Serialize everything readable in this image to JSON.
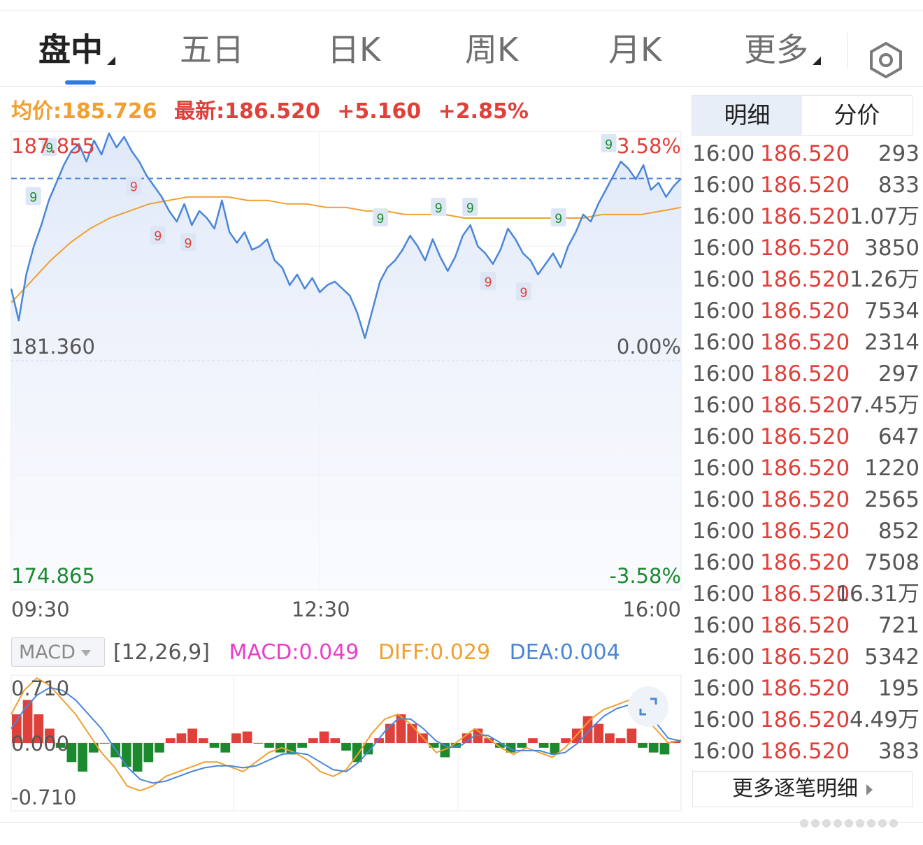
{
  "tabs": [
    {
      "label": "盘中",
      "active": true,
      "has_caret": true
    },
    {
      "label": "五日",
      "active": false,
      "has_caret": false
    },
    {
      "label": "日K",
      "active": false,
      "has_caret": false
    },
    {
      "label": "周K",
      "active": false,
      "has_caret": false
    },
    {
      "label": "月K",
      "active": false,
      "has_caret": false
    },
    {
      "label": "更多",
      "active": false,
      "has_caret": true
    }
  ],
  "settings_icon": "hexagon-gear-icon",
  "info": {
    "avg": "均价:185.726",
    "latest": "最新:186.520",
    "change": "+5.160",
    "change_pct": "+2.85%"
  },
  "colors": {
    "up": "#e0403a",
    "down": "#1b8a2e",
    "price_line": "#4a86d8",
    "avg_line": "#f0a030",
    "macd": "#e83ecb",
    "diff": "#f0a030",
    "dea": "#4a86d8",
    "tab_active_underline": "#2e7be6"
  },
  "price_axis": {
    "top_price": "187.855",
    "mid_price": "181.360",
    "bottom_price": "174.865",
    "top_pct": "3.58%",
    "mid_pct": "0.00%",
    "bottom_pct": "-3.58%",
    "prev_close": 181.36,
    "max": 187.855,
    "min": 174.865
  },
  "time_axis": [
    "09:30",
    "12:30",
    "16:00"
  ],
  "chart_data": {
    "type": "line",
    "x_labels": [
      "09:30",
      "12:30",
      "16:00"
    ],
    "y_range": [
      174.865,
      187.855
    ],
    "series": [
      {
        "values": [
          183.4,
          182.5,
          183.8,
          184.6,
          185.2,
          185.9,
          186.4,
          186.9,
          187.3,
          187.5,
          187.0,
          187.6,
          187.2,
          187.8,
          187.4,
          187.7,
          187.3,
          187.0,
          186.6,
          186.3,
          186.0,
          185.6,
          185.3,
          185.8,
          185.2,
          185.6,
          185.4,
          185.1,
          185.9,
          185.0,
          184.7,
          185.0,
          184.5,
          184.6,
          184.8,
          184.2,
          184.0,
          183.5,
          183.8,
          183.4,
          183.7,
          183.3,
          183.5,
          183.6,
          183.4,
          183.2,
          182.7,
          182.0,
          182.8,
          183.6,
          184.0,
          184.2,
          184.5,
          184.9,
          184.6,
          184.2,
          184.8,
          184.3,
          183.9,
          184.3,
          184.9,
          185.2,
          184.6,
          184.4,
          184.1,
          184.5,
          185.1,
          184.8,
          184.4,
          184.2,
          183.8,
          184.1,
          184.4,
          184.0,
          184.6,
          185.0,
          185.5,
          185.3,
          185.8,
          186.2,
          186.6,
          187.0,
          186.8,
          186.5,
          186.9,
          186.2,
          186.4,
          186.0,
          186.3,
          186.52
        ]
      }
    ]
  },
  "avg_values": [
    183.0,
    183.6,
    184.2,
    184.7,
    185.1,
    185.4,
    185.6,
    185.8,
    185.9,
    186.0,
    186.0,
    186.0,
    185.9,
    185.9,
    185.8,
    185.8,
    185.7,
    185.7,
    185.6,
    185.6,
    185.5,
    185.5,
    185.5,
    185.4,
    185.4,
    185.4,
    185.4,
    185.4,
    185.4,
    185.4,
    185.5,
    185.5,
    185.5,
    185.6,
    185.7
  ],
  "td_markers": [
    {
      "label": "9",
      "color": "green",
      "x": 0.033,
      "price": 186.0
    },
    {
      "label": "9",
      "color": "green",
      "x": 0.057,
      "price": 187.4
    },
    {
      "label": "9",
      "color": "red",
      "x": 0.183,
      "price": 186.3
    },
    {
      "label": "9",
      "color": "red",
      "x": 0.219,
      "price": 184.9
    },
    {
      "label": "9",
      "color": "red",
      "x": 0.264,
      "price": 184.7
    },
    {
      "label": "9",
      "color": "green",
      "x": 0.551,
      "price": 185.4
    },
    {
      "label": "9",
      "color": "green",
      "x": 0.638,
      "price": 185.7
    },
    {
      "label": "9",
      "color": "green",
      "x": 0.685,
      "price": 185.7
    },
    {
      "label": "9",
      "color": "red",
      "x": 0.712,
      "price": 183.6
    },
    {
      "label": "9",
      "color": "red",
      "x": 0.765,
      "price": 183.3
    },
    {
      "label": "9",
      "color": "green",
      "x": 0.817,
      "price": 185.4
    },
    {
      "label": "9",
      "color": "green",
      "x": 0.892,
      "price": 187.5
    }
  ],
  "macd": {
    "selector_label": "MACD",
    "params": "[12,26,9]",
    "macd_value": "MACD:0.049",
    "diff_value": "DIFF:0.029",
    "dea_value": "DEA:0.004",
    "axis_top": "0.710",
    "axis_mid": "0.000",
    "axis_bottom": "-0.710",
    "range": [
      -0.71,
      0.71
    ],
    "hist": [
      0.3,
      0.45,
      0.3,
      0.15,
      -0.05,
      -0.2,
      -0.3,
      -0.1,
      0.0,
      -0.15,
      -0.25,
      -0.3,
      -0.2,
      -0.1,
      0.05,
      0.1,
      0.15,
      0.05,
      -0.05,
      -0.1,
      0.1,
      0.12,
      0.0,
      -0.05,
      -0.1,
      -0.12,
      -0.05,
      0.05,
      0.12,
      0.05,
      -0.08,
      -0.2,
      -0.12,
      0.05,
      0.2,
      0.3,
      0.2,
      0.1,
      -0.05,
      -0.15,
      -0.05,
      0.1,
      0.15,
      0.05,
      -0.05,
      -0.1,
      -0.05,
      0.05,
      -0.05,
      -0.12,
      0.05,
      0.15,
      0.28,
      0.2,
      0.1,
      0.05,
      0.15,
      -0.05,
      -0.1,
      -0.12,
      0.02
    ],
    "diff": [
      0.3,
      0.55,
      0.68,
      0.6,
      0.45,
      0.3,
      0.1,
      -0.1,
      -0.25,
      -0.45,
      -0.5,
      -0.45,
      -0.35,
      -0.3,
      -0.25,
      -0.2,
      -0.2,
      -0.25,
      -0.3,
      -0.2,
      -0.1,
      -0.05,
      -0.1,
      -0.18,
      -0.3,
      -0.35,
      -0.28,
      -0.1,
      0.1,
      0.25,
      0.3,
      0.2,
      0.05,
      -0.1,
      -0.05,
      0.05,
      0.15,
      0.05,
      -0.05,
      -0.12,
      -0.05,
      -0.1,
      -0.15,
      -0.05,
      0.1,
      0.25,
      0.35,
      0.4,
      0.45,
      0.3,
      0.15,
      0.0,
      0.03
    ],
    "dea": [
      0.15,
      0.35,
      0.5,
      0.58,
      0.55,
      0.45,
      0.3,
      0.15,
      -0.05,
      -0.25,
      -0.38,
      -0.42,
      -0.4,
      -0.35,
      -0.3,
      -0.26,
      -0.24,
      -0.24,
      -0.26,
      -0.24,
      -0.18,
      -0.12,
      -0.1,
      -0.12,
      -0.2,
      -0.28,
      -0.3,
      -0.2,
      -0.05,
      0.12,
      0.25,
      0.25,
      0.15,
      0.02,
      -0.05,
      -0.02,
      0.08,
      0.08,
      0.0,
      -0.08,
      -0.08,
      -0.08,
      -0.12,
      -0.1,
      0.0,
      0.15,
      0.28,
      0.36,
      0.4,
      0.36,
      0.22,
      0.05,
      0.02
    ]
  },
  "detail_tabs": [
    {
      "label": "明细",
      "active": true
    },
    {
      "label": "分价",
      "active": false
    }
  ],
  "ticks": [
    {
      "time": "16:00",
      "price": "186.520",
      "vol": "293"
    },
    {
      "time": "16:00",
      "price": "186.520",
      "vol": "833"
    },
    {
      "time": "16:00",
      "price": "186.520",
      "vol": "1.07万"
    },
    {
      "time": "16:00",
      "price": "186.520",
      "vol": "3850"
    },
    {
      "time": "16:00",
      "price": "186.520",
      "vol": "1.26万"
    },
    {
      "time": "16:00",
      "price": "186.520",
      "vol": "7534"
    },
    {
      "time": "16:00",
      "price": "186.520",
      "vol": "2314"
    },
    {
      "time": "16:00",
      "price": "186.520",
      "vol": "297"
    },
    {
      "time": "16:00",
      "price": "186.520",
      "vol": "7.45万"
    },
    {
      "time": "16:00",
      "price": "186.520",
      "vol": "647"
    },
    {
      "time": "16:00",
      "price": "186.520",
      "vol": "1220"
    },
    {
      "time": "16:00",
      "price": "186.520",
      "vol": "2565"
    },
    {
      "time": "16:00",
      "price": "186.520",
      "vol": "852"
    },
    {
      "time": "16:00",
      "price": "186.520",
      "vol": "7508"
    },
    {
      "time": "16:00",
      "price": "186.520",
      "vol": "16.31万"
    },
    {
      "time": "16:00",
      "price": "186.520",
      "vol": "721"
    },
    {
      "time": "16:00",
      "price": "186.520",
      "vol": "5342"
    },
    {
      "time": "16:00",
      "price": "186.520",
      "vol": "195"
    },
    {
      "time": "16:00",
      "price": "186.520",
      "vol": "4.49万"
    },
    {
      "time": "16:00",
      "price": "186.520",
      "vol": "383"
    }
  ],
  "more_detail": "更多逐笔明细",
  "expand_icon": "expand-icon"
}
